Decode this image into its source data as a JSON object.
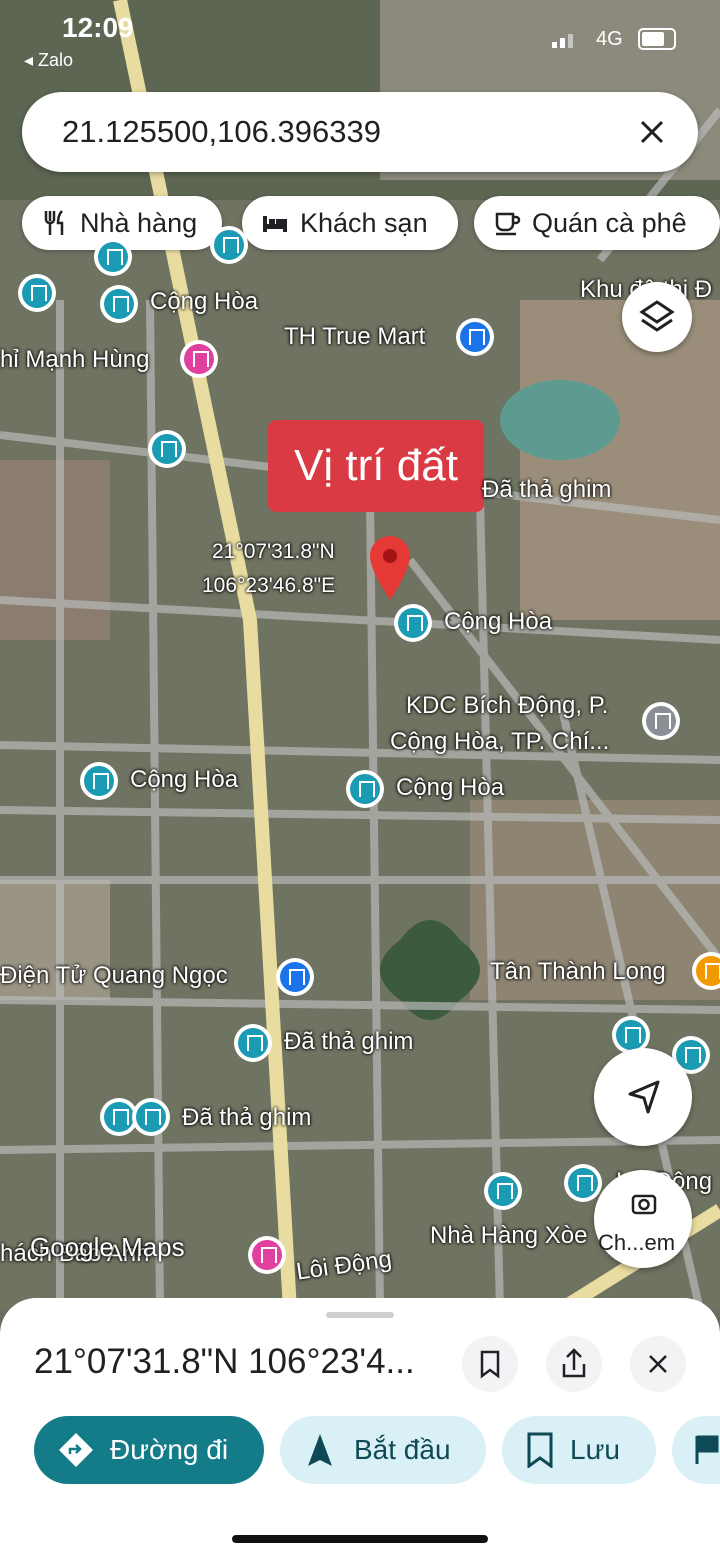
{
  "status": {
    "time": "12:09",
    "back_app": "Zalo",
    "network": "4G"
  },
  "search": {
    "query": "21.125500,106.396339"
  },
  "chips": [
    {
      "label": "Nhà hàng"
    },
    {
      "label": "Khách sạn"
    },
    {
      "label": "Quán cà phê"
    }
  ],
  "map": {
    "attribution": "Google Maps",
    "selected_label": "Vị trí đất",
    "marker_coords_line1": "21°07'31.8\"N",
    "marker_coords_line2": "106°23'46.8\"E",
    "places": {
      "cong_hoa_1": "Cộng Hòa",
      "khu_do_thi": "Khu đô thị Đ",
      "th_true_mart": "TH True Mart",
      "manh_hung": "hỉ Mạnh Hùng",
      "da_tha_ghim_top": "Đã thả ghim",
      "cong_hoa_2": "Cộng Hòa",
      "kdc_line1": "KDC Bích Động, P.",
      "kdc_line2": "Cộng Hòa, TP. Chí...",
      "cong_hoa_3": "Cộng Hòa",
      "cong_hoa_4": "Cộng Hòa",
      "dien_tu": "Điện Tử Quang Ngọc",
      "tan_thanh_long": "Tân Thành Long",
      "da_tha_ghim_mid": "Đã thả ghim",
      "da_tha_ghim_low": "Đã thả ghim",
      "nha_hang_xoe": "Nhà Hàng Xòe",
      "loi_dong_1": "Lôi Động",
      "loi_dong_2": "Lôi Động",
      "thach_bao_anh": "hách Bảo Anh",
      "da_tha_ghim_faded": "Đã thả ghim"
    },
    "camera_label": "Ch...em"
  },
  "sheet": {
    "title": "21°07'31.8\"N 106°23'4...",
    "actions": [
      {
        "label": "Đường đi"
      },
      {
        "label": "Bắt đầu"
      },
      {
        "label": "Lưu"
      }
    ]
  },
  "colors": {
    "accent": "#137c88",
    "pin": "#1a9bb3",
    "red_marker": "#d93a43",
    "pill_bg": "#d9f0f7"
  }
}
